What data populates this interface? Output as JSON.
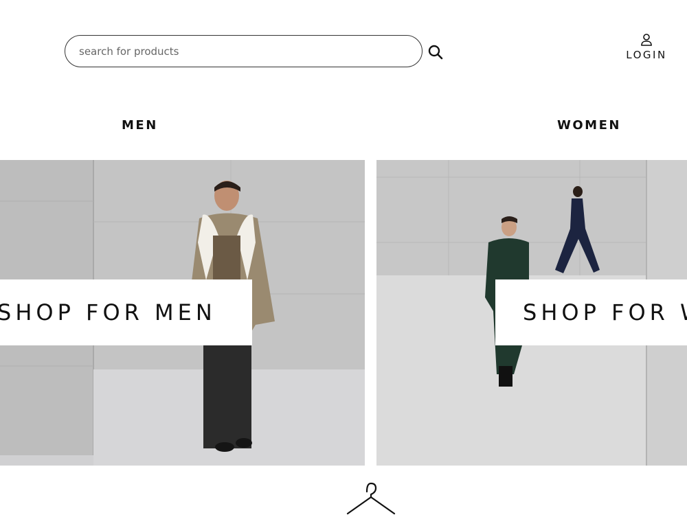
{
  "header": {
    "search": {
      "placeholder": "search for products",
      "value": ""
    },
    "search_icon": "search-icon",
    "login": {
      "label": "LOGIN",
      "icon": "user-icon"
    }
  },
  "categories": [
    {
      "label": "MEN",
      "cta": "SHOP FOR MEN"
    },
    {
      "label": "WOMEN",
      "cta": "SHOP FOR WOMEN"
    }
  ],
  "footer_icon": "hanger-icon"
}
